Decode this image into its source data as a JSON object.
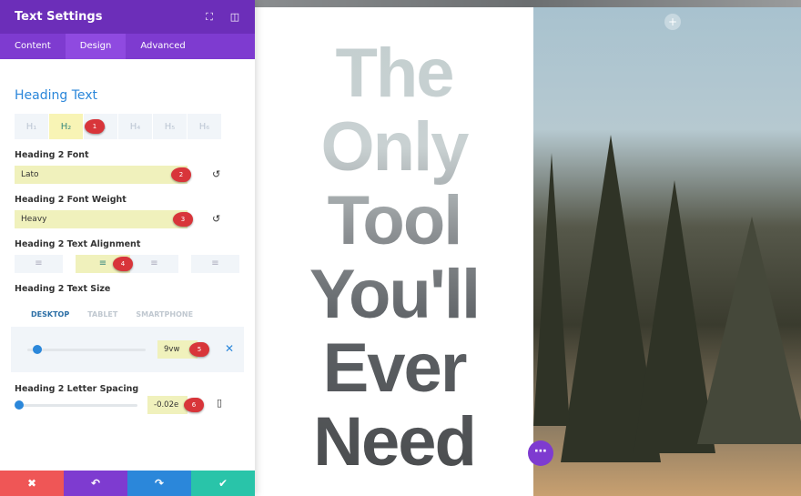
{
  "panel": {
    "title": "Text Settings",
    "tabs": [
      {
        "label": "Content"
      },
      {
        "label": "Design"
      },
      {
        "label": "Advanced"
      }
    ],
    "section": "Heading Text",
    "heading_levels": [
      "H₁",
      "H₂",
      "H₃",
      "H₄",
      "H₅",
      "H₆"
    ],
    "font_label": "Heading 2 Font",
    "font_value": "Lato",
    "weight_label": "Heading 2 Font Weight",
    "weight_value": "Heavy",
    "align_label": "Heading 2 Text Alignment",
    "size_label": "Heading 2 Text Size",
    "device_tabs": [
      "DESKTOP",
      "TABLET",
      "SMARTPHONE"
    ],
    "size_value": "9vw",
    "spacing_label": "Heading 2 Letter Spacing",
    "spacing_value": "-0.02e",
    "markers": [
      "1",
      "2",
      "3",
      "4",
      "5",
      "6"
    ],
    "footer": {
      "cancel": "✖",
      "undo": "↶",
      "redo": "↷",
      "save": "✔"
    }
  },
  "canvas": {
    "heading_lines": [
      "The",
      "Only",
      "Tool",
      "You'll",
      "Ever",
      "Need"
    ]
  },
  "colors": {
    "header": "#6c2eb9",
    "accent": "#2b87da",
    "cancel": "#ef5656",
    "undo": "#7e3bd0",
    "redo": "#2b87da",
    "save": "#29c4a9"
  }
}
